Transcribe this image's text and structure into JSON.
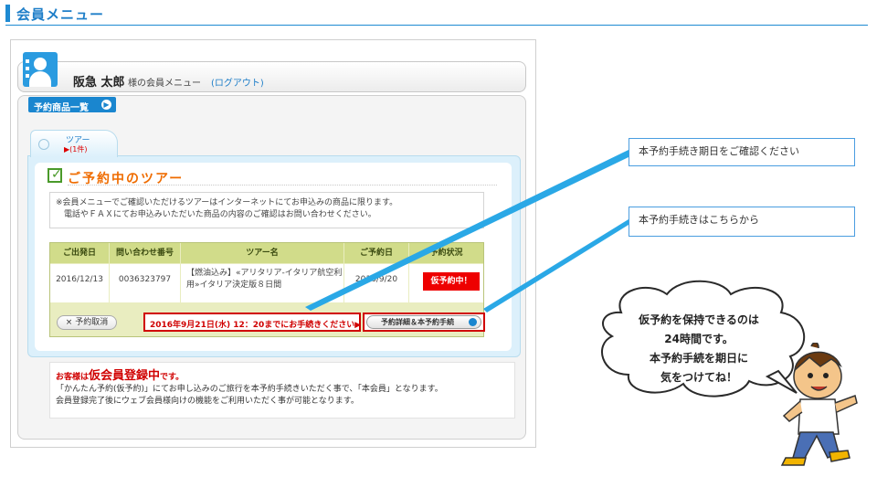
{
  "header": {
    "title": "会員メニュー"
  },
  "user": {
    "name": "阪急 太郎",
    "suffix": "様の会員メニュー",
    "logout": "(ログアウト)"
  },
  "nav": {
    "list_button": "予約商品一覧"
  },
  "tab": {
    "label": "ツアー",
    "count": "▶(1件)"
  },
  "section": {
    "title": "ご予約中のツアー",
    "notice_line1": "※会員メニューでご確認いただけるツアーはインターネットにてお申込みの商品に限ります。",
    "notice_line2": "電話やＦＡＸにてお申込みいただいた商品の内容のご確認はお問い合わせください。"
  },
  "table": {
    "headers": [
      "ご出発日",
      "問い合わせ番号",
      "ツアー名",
      "ご予約日",
      "予約状況"
    ],
    "row": {
      "departure": "2016/12/13",
      "inquiry_no": "0036323797",
      "tour_name_line1": "【燃油込み】«アリタリア-イタリア航空利",
      "tour_name_line2": "用»イタリア決定版８日間",
      "reserved_on": "2016/9/20",
      "status": "仮予約中！"
    }
  },
  "actions": {
    "cancel": "× 予約取消",
    "deadline": "2016年9月21日(水) 12：20までにお手続きください▶",
    "detail": "予約詳細＆本予約手続"
  },
  "member": {
    "lead": "お客様は",
    "status": "仮会員登録中",
    "lead_end": "です。",
    "line1": "「かんたん予約(仮予約)」にてお申し込みのご旅行を本予約手続きいただく事で、「本会員」となります。",
    "line2": "会員登録完了後にウェブ会員様向けの機能をご利用いただく事が可能となります。"
  },
  "callouts": {
    "deadline_note": "本予約手続き期日をご確認ください",
    "procedure_note": "本予約手続きはこちらから"
  },
  "cloud": {
    "line1": "仮予約を保持できるのは",
    "line2": "24時間です。",
    "line3": "本予約手続を期日に",
    "line4": "気をつけてね！"
  },
  "colors": {
    "accent": "#1e8ad2",
    "alert": "#d00000",
    "title_orange": "#ef6c00",
    "table_header": "#d1dc8a"
  },
  "icons": [
    "user-avatar-icon",
    "globe-icon",
    "check-icon",
    "arrow-right-icon"
  ]
}
